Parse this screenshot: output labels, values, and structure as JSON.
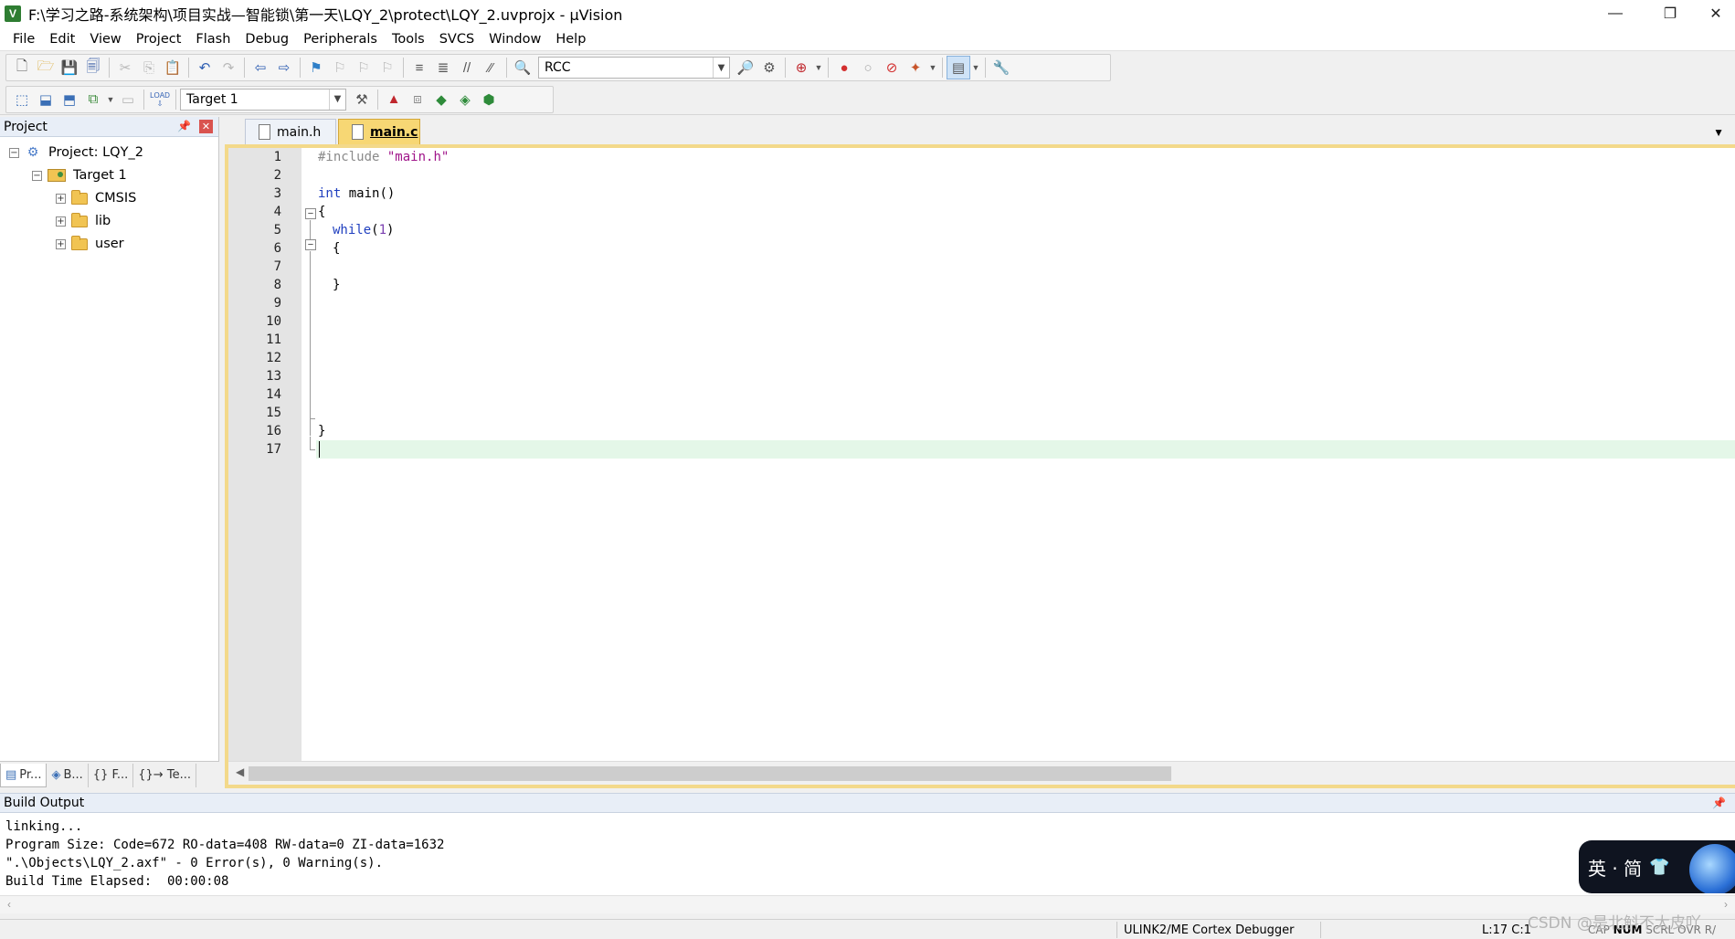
{
  "window": {
    "title": "F:\\学习之路-系统架构\\项目实战—智能锁\\第一天\\LQY_2\\protect\\LQY_2.uvprojx - µVision",
    "icon": "V",
    "minimize": "—",
    "restore": "❐",
    "close": "✕"
  },
  "menu": [
    "File",
    "Edit",
    "View",
    "Project",
    "Flash",
    "Debug",
    "Peripherals",
    "Tools",
    "SVCS",
    "Window",
    "Help"
  ],
  "toolbar": {
    "find_combo_value": "RCC",
    "target_combo_value": "Target 1",
    "load_label": "LOAD"
  },
  "project_panel": {
    "title": "Project",
    "root": "Project: LQY_2",
    "target": "Target 1",
    "groups": [
      "CMSIS",
      "lib",
      "user"
    ],
    "tabs": [
      "Pr...",
      "B...",
      "{} F...",
      "{}→ Te..."
    ]
  },
  "editor": {
    "tabs": [
      "main.h",
      "main.c"
    ],
    "active_tab": "main.c",
    "line_numbers": [
      "1",
      "2",
      "3",
      "4",
      "5",
      "6",
      "7",
      "8",
      "9",
      "10",
      "11",
      "12",
      "13",
      "14",
      "15",
      "16",
      "17"
    ],
    "code": {
      "l1_directive": "#include",
      "l1_string": "\"main.h\"",
      "l3_type": "int",
      "l3_rest": " main()",
      "l4": "{",
      "l5_kw": "while",
      "l5_open": "(",
      "l5_num": "1",
      "l5_close": ")",
      "l6": "{",
      "l8": "}",
      "l16": "}"
    }
  },
  "build_output": {
    "title": "Build Output",
    "lines": [
      "linking...",
      "Program Size: Code=672 RO-data=408 RW-data=0 ZI-data=1632",
      "\".\\Objects\\LQY_2.axf\" - 0 Error(s), 0 Warning(s).",
      "Build Time Elapsed:  00:00:08"
    ]
  },
  "ime": {
    "text": "英 · 简"
  },
  "status": {
    "debugger": "ULINK2/ME Cortex Debugger",
    "position": "L:17 C:1",
    "cap": "CAP",
    "num": "NUM",
    "scrl": "SCRL",
    "ovr": "OVR",
    "rw": "R/"
  },
  "watermark": "CSDN @是北斛不太皮吖"
}
